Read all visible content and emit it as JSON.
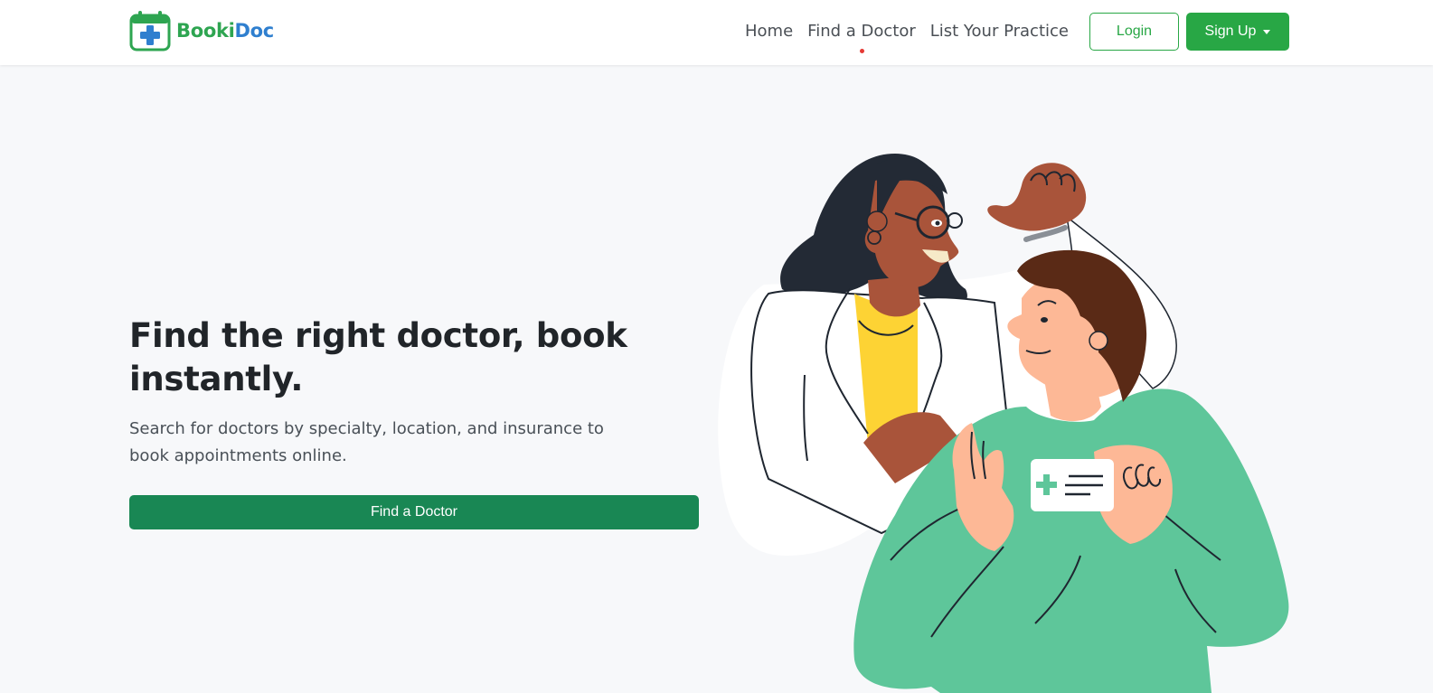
{
  "brand": {
    "name_part1": "Booki",
    "name_part2": "Doc",
    "logo_icon": "calendar-medical-cross-icon"
  },
  "nav": {
    "links": [
      {
        "label": "Home"
      },
      {
        "label": "Find a Doctor"
      },
      {
        "label": "List Your Practice"
      }
    ],
    "login_label": "Login",
    "signup_label": "Sign Up"
  },
  "hero": {
    "title": "Find the right doctor, book instantly.",
    "subtitle": "Search for doctors by specialty, location, and insurance to book appointments online.",
    "cta_label": "Find a Doctor"
  },
  "colors": {
    "brand_green": "#2ea551",
    "brand_blue": "#2f7fcf",
    "primary_button": "#28a745",
    "cta_button": "#198754",
    "hero_background": "#f7f8fa",
    "active_nav_dot": "#e53935"
  }
}
